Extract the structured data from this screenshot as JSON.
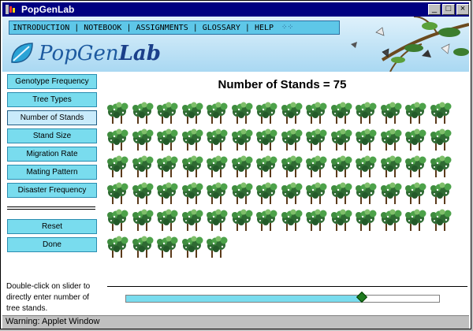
{
  "window": {
    "title": "PopGenLab",
    "controls": {
      "minimize": "_",
      "maximize": "□",
      "close": "×"
    }
  },
  "nav": {
    "items": [
      "INTRODUCTION",
      "NOTEBOOK",
      "ASSIGNMENTS",
      "GLOSSARY",
      "HELP"
    ],
    "separator": "|"
  },
  "logo": {
    "text_regular": "PopGen",
    "text_bold": "Lab"
  },
  "menu": {
    "items": [
      {
        "label": "Genotype Frequency",
        "active": false
      },
      {
        "label": "Tree Types",
        "active": false
      },
      {
        "label": "Number of Stands",
        "active": true
      },
      {
        "label": "Stand Size",
        "active": false
      },
      {
        "label": "Migration Rate",
        "active": false
      },
      {
        "label": "Mating Pattern",
        "active": false
      },
      {
        "label": "Disaster Frequency",
        "active": false
      }
    ],
    "actions": [
      {
        "label": "Reset"
      },
      {
        "label": "Done"
      }
    ]
  },
  "main": {
    "title": "Number of Stands = 75",
    "stand_count": 75,
    "stand_icon": "tree-cluster-icon"
  },
  "slider": {
    "help_text": "Double-click on slider to directly enter number of tree stands.",
    "fraction": 0.75
  },
  "status": {
    "text": "Warning: Applet Window"
  },
  "colors": {
    "titlebar": "#000080",
    "menu_button": "#79dcee",
    "menu_button_active": "#c9ebfb",
    "slider_fill": "#79dcee",
    "slider_thumb": "#1f7a1f",
    "tree_foliage": "#2f6b33"
  }
}
